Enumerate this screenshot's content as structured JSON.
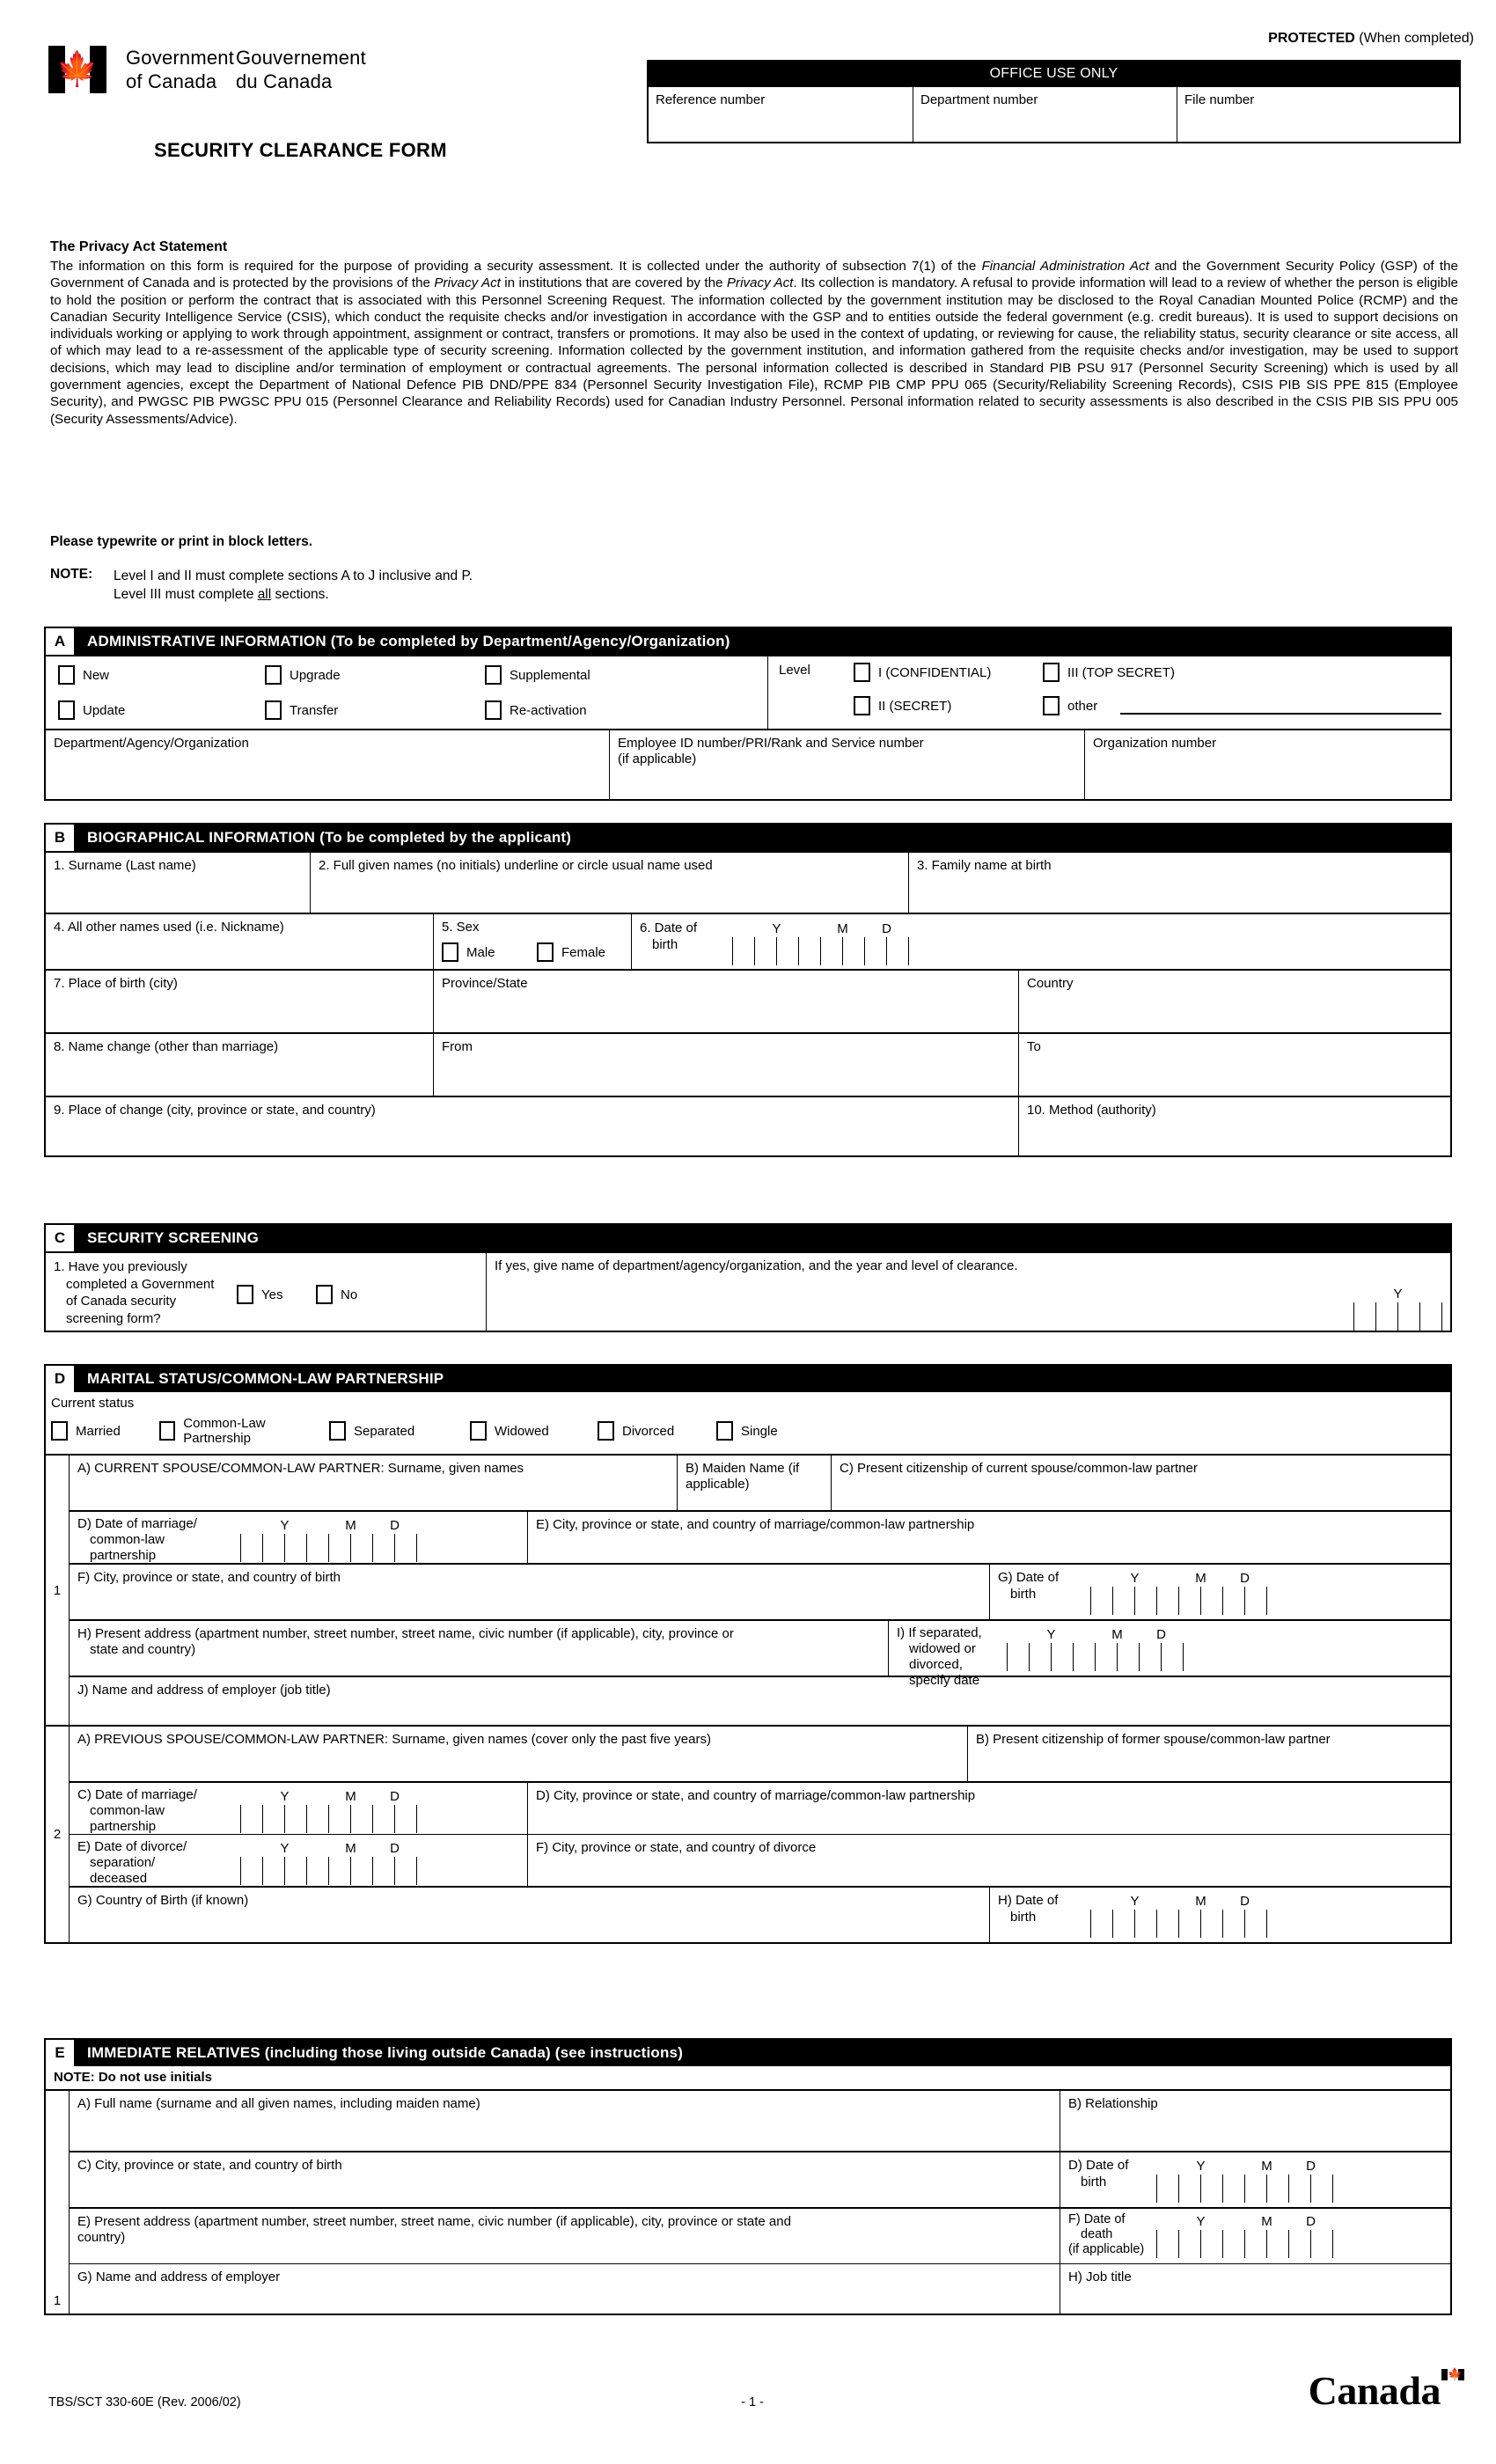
{
  "header": {
    "govt_en_line1": "Government",
    "govt_en_line2": "of Canada",
    "govt_fr_line1": "Gouvernement",
    "govt_fr_line2": "du Canada",
    "form_title": "SECURITY CLEARANCE FORM",
    "protected_bold": "PROTECTED",
    "protected_rest": "(When completed)",
    "office_use_title": "OFFICE USE ONLY",
    "office_fields": [
      "Reference number",
      "Department number",
      "File number"
    ]
  },
  "privacy": {
    "heading": "The Privacy Act Statement",
    "body_html": "The information on this form is required for the purpose of providing a security assessment.  It is collected under the authority of subsection 7(1) of the <em>Financial Administration Act</em> and the Government Security Policy (GSP) of the Government of Canada and is protected by the provisions of the <em>Privacy Act</em> in institutions that are covered by the <em>Privacy Act</em>.  Its collection is mandatory.  A refusal to provide information will lead to a review of whether the person is eligible to hold the position or perform the contract that is associated with this Personnel Screening Request. The information collected by the government institution may be disclosed to the Royal Canadian Mounted Police (RCMP) and the Canadian Security Intelligence Service (CSIS), which conduct the requisite checks and/or investigation in accordance with the GSP and to entities outside the federal government (e.g. credit bureaus).  It is used to support decisions on individuals working or applying to work through appointment, assignment or contract, transfers or promotions.  It may also be used in the context of updating, or reviewing for cause, the reliability status, security clearance or site access, all of which may lead to a re-assessment of the applicable type of security screening. Information collected by the government institution, and information gathered from the requisite checks and/or investigation, may be used to support decisions, which may lead to discipline and/or termination of employment or contractual agreements.  The personal information collected is described in Standard PIB PSU 917 (Personnel Security Screening) which is used by all government agencies, except the Department of National Defence PIB DND/PPE 834 (Personnel Security Investigation File), RCMP PIB CMP PPU 065 (Security/Reliability Screening Records), CSIS PIB SIS PPE 815 (Employee Security), and PWGSC PIB PWGSC PPU 015 (Personnel Clearance and Reliability Records) used for Canadian Industry Personnel.  Personal information related to security assessments is also described in the CSIS PIB SIS PPU 005 (Security Assessments/Advice)."
  },
  "instructions": {
    "typewrite": "Please typewrite or print in block letters.",
    "note_label": "NOTE:",
    "note_line1": "Level I and II must complete sections A to J inclusive and P.",
    "note_line2_pre": "Level III must complete ",
    "note_line2_u": "all",
    "note_line2_post": " sections."
  },
  "section_a": {
    "letter": "A",
    "title": "ADMINISTRATIVE INFORMATION  (To be completed by Department/Agency/Organization)",
    "checkboxes": [
      "New",
      "Upgrade",
      "Supplemental",
      "Update",
      "Transfer",
      "Re-activation"
    ],
    "level_label": "Level",
    "levels": [
      "I (CONFIDENTIAL)",
      "III (TOP SECRET)",
      "II (SECRET)",
      "other"
    ],
    "dept_label": "Department/Agency/Organization",
    "employee_label_l1": "Employee ID number/PRI/Rank and Service number",
    "employee_label_l2": "(if applicable)",
    "org_number_label": "Organization number"
  },
  "section_b": {
    "letter": "B",
    "title": "BIOGRAPHICAL INFORMATION  (To be completed by the applicant)",
    "f1": "1. Surname (Last name)",
    "f2": "2. Full given names (no initials) underline or circle usual name used",
    "f3": "3. Family name at birth",
    "f4": "4. All other names used (i.e. Nickname)",
    "f5": "5. Sex",
    "sex_options": [
      "Male",
      "Female"
    ],
    "f6_l1": "6. Date of",
    "f6_l2": "birth",
    "f7": "7. Place of birth (city)",
    "f7b": "Province/State",
    "f7c": "Country",
    "f8": "8. Name change (other than marriage)",
    "f8b": "From",
    "f8c": "To",
    "f9": "9. Place of change (city, province or state, and country)",
    "f10": "10. Method (authority)"
  },
  "section_c": {
    "letter": "C",
    "title": "SECURITY SCREENING",
    "q1_lines": [
      "1. Have you previously",
      "completed a Government",
      "of Canada security",
      "screening form?"
    ],
    "yes": "Yes",
    "no": "No",
    "if_yes": "If yes, give name of  department/agency/organization, and the year and level of clearance."
  },
  "section_d": {
    "letter": "D",
    "title": "MARITAL STATUS/COMMON-LAW PARTNERSHIP",
    "current_status": "Current  status",
    "statuses": [
      "Married",
      "Common-Law Partnership",
      "Separated",
      "Widowed",
      "Divorced",
      "Single"
    ],
    "block1": {
      "num": "1",
      "a": "A) CURRENT SPOUSE/COMMON-LAW PARTNER:  Surname, given names",
      "b": "B) Maiden Name (if applicable)",
      "c": "C) Present citizenship of current spouse/common-law partner",
      "d_lines": [
        "D) Date of marriage/",
        "common-law",
        "partnership"
      ],
      "e": "E) City, province or state, and country of marriage/common-law partnership",
      "f": "F) City, province or state, and country of birth",
      "g_lines": [
        "G) Date of",
        "birth"
      ],
      "h_lines": [
        "H) Present address (apartment number, street number, street name, civic number (if applicable), city, province or",
        "state and country)"
      ],
      "i_lines": [
        "I)  If separated,",
        "widowed or divorced,",
        "specify date"
      ],
      "j": "J) Name and address of employer (job title)"
    },
    "block2": {
      "num": "2",
      "a": "A) PREVIOUS SPOUSE/COMMON-LAW PARTNER:  Surname, given names (cover only the past five years)",
      "b": "B) Present citizenship of former spouse/common-law partner",
      "c_lines": [
        "C) Date of marriage/",
        "common-law",
        "partnership"
      ],
      "d": "D) City, province or state, and country of marriage/common-law partnership",
      "e_lines": [
        "E) Date of divorce/",
        "separation/",
        "deceased"
      ],
      "f": "F) City, province or state, and country of divorce",
      "g": "G) Country of Birth (if known)",
      "h_lines": [
        "H) Date of",
        "birth"
      ]
    }
  },
  "section_e": {
    "letter": "E",
    "title": "IMMEDIATE RELATIVES (including those living outside Canada) (see instructions)",
    "note": "NOTE: Do not use initials",
    "num": "1",
    "a": "A) Full name (surname and all given names, including maiden name)",
    "b": "B) Relationship",
    "c": "C) City, province or state, and country of birth",
    "d_lines": [
      "D) Date of",
      "birth"
    ],
    "e_lines": [
      "E) Present address (apartment number, street number, street name, civic number (if applicable), city, province or state and",
      "country)"
    ],
    "f_lines": [
      "F) Date of",
      "death",
      "(if applicable)"
    ],
    "g": "G) Name and address of employer",
    "h": "H) Job title"
  },
  "date_headers": {
    "y": "Y",
    "m": "M",
    "d": "D"
  },
  "footer": {
    "form_code": "TBS/SCT 330-60E (Rev. 2006/02)",
    "page": "- 1 -",
    "wordmark": "Canada"
  }
}
